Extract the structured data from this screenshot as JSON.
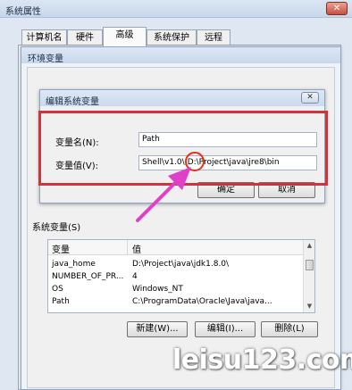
{
  "window": {
    "title": "系统属性",
    "close_label": "✕"
  },
  "tabs": [
    {
      "label": "计算机名"
    },
    {
      "label": "硬件"
    },
    {
      "label": "高级"
    },
    {
      "label": "系统保护"
    },
    {
      "label": "远程"
    }
  ],
  "env_dialog": {
    "title": "环境变量"
  },
  "edit_dialog": {
    "title": "编辑系统变量",
    "close_label": "✕",
    "name_label": "变量名(N):",
    "name_value": "Path",
    "value_label": "变量值(V):",
    "value_value": "Shell\\v1.0\\;D:\\Project\\java\\jre8\\bin",
    "ok_label": "确定",
    "cancel_label": "取消"
  },
  "system_vars": {
    "group_title": "系统变量(S)",
    "columns": [
      "变量",
      "值"
    ],
    "rows": [
      {
        "name": "java_home",
        "value": "D:\\Project\\java\\jdk1.8.0\\"
      },
      {
        "name": "NUMBER_OF_PR...",
        "value": "4"
      },
      {
        "name": "OS",
        "value": "Windows_NT"
      },
      {
        "name": "Path",
        "value": "C:\\ProgramData\\Oracle\\Java\\java..."
      }
    ],
    "new_label": "新建(W)...",
    "edit_label": "编辑(I)...",
    "delete_label": "删除(L)"
  },
  "watermark": "leisu123.com",
  "colors": {
    "highlight_red": "#d1323c",
    "arrow_magenta": "#e040c8"
  }
}
